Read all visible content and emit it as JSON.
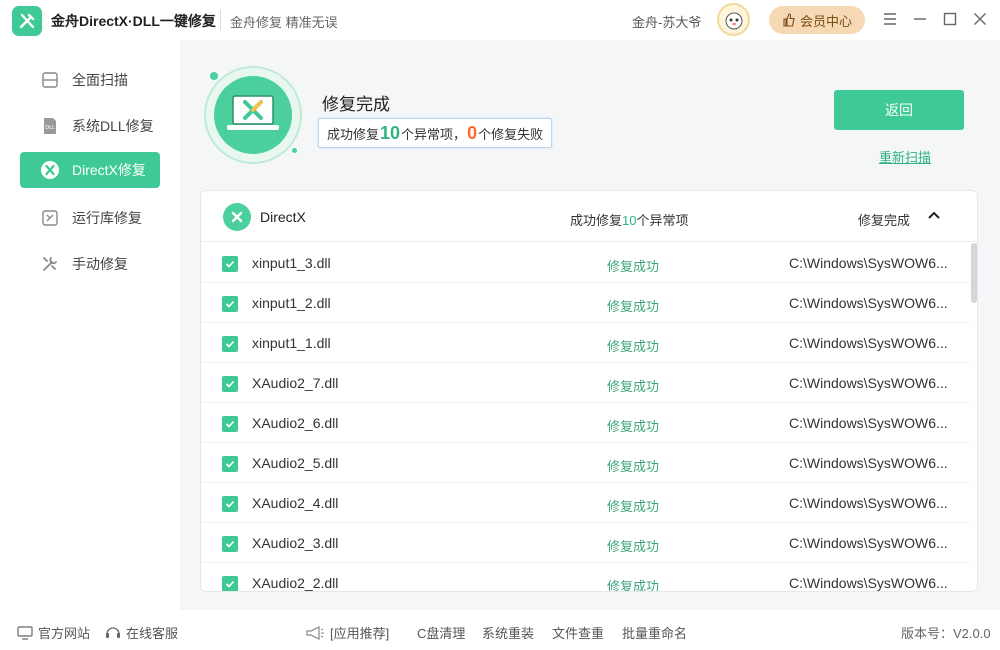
{
  "titlebar": {
    "app_title": "金舟DirectX·DLL一键修复",
    "slogan": "金舟修复 精准无误",
    "user_name": "金舟-苏大爷",
    "vip_label": "会员中心"
  },
  "sidebar": {
    "items": [
      {
        "label": "全面扫描",
        "icon": "scan-icon",
        "active": false
      },
      {
        "label": "系统DLL修复",
        "icon": "dll-icon",
        "active": false
      },
      {
        "label": "DirectX修复",
        "icon": "directx-icon",
        "active": true
      },
      {
        "label": "运行库修复",
        "icon": "runtime-icon",
        "active": false
      },
      {
        "label": "手动修复",
        "icon": "wrench-icon",
        "active": false
      }
    ]
  },
  "status": {
    "title": "修复完成",
    "summary_prefix": "成功修复",
    "success_count": "10",
    "summary_mid": "个异常项，",
    "fail_count": "0",
    "summary_suffix": "个修复失败",
    "back_label": "返回",
    "rescan_label": "重新扫描"
  },
  "panel": {
    "name": "DirectX",
    "stat_prefix": "成功修复",
    "stat_count": "10",
    "stat_suffix": "个异常项",
    "state": "修复完成",
    "rows": [
      {
        "file": "xinput1_3.dll",
        "state": "修复成功",
        "path": "C:\\Windows\\SysWOW6..."
      },
      {
        "file": "xinput1_2.dll",
        "state": "修复成功",
        "path": "C:\\Windows\\SysWOW6..."
      },
      {
        "file": "xinput1_1.dll",
        "state": "修复成功",
        "path": "C:\\Windows\\SysWOW6..."
      },
      {
        "file": "XAudio2_7.dll",
        "state": "修复成功",
        "path": "C:\\Windows\\SysWOW6..."
      },
      {
        "file": "XAudio2_6.dll",
        "state": "修复成功",
        "path": "C:\\Windows\\SysWOW6..."
      },
      {
        "file": "XAudio2_5.dll",
        "state": "修复成功",
        "path": "C:\\Windows\\SysWOW6..."
      },
      {
        "file": "XAudio2_4.dll",
        "state": "修复成功",
        "path": "C:\\Windows\\SysWOW6..."
      },
      {
        "file": "XAudio2_3.dll",
        "state": "修复成功",
        "path": "C:\\Windows\\SysWOW6..."
      },
      {
        "file": "XAudio2_2.dll",
        "state": "修复成功",
        "path": "C:\\Windows\\SysWOW6..."
      }
    ]
  },
  "footer": {
    "website": "官方网站",
    "support": "在线客服",
    "recommend": "[应用推荐]",
    "links": [
      "C盘清理",
      "系统重装",
      "文件查重",
      "批量重命名"
    ],
    "version": "版本号：V2.0.0"
  },
  "colors": {
    "accent": "#3ec996",
    "fail": "#ff6a2a",
    "vip": "#f6d9b4"
  }
}
